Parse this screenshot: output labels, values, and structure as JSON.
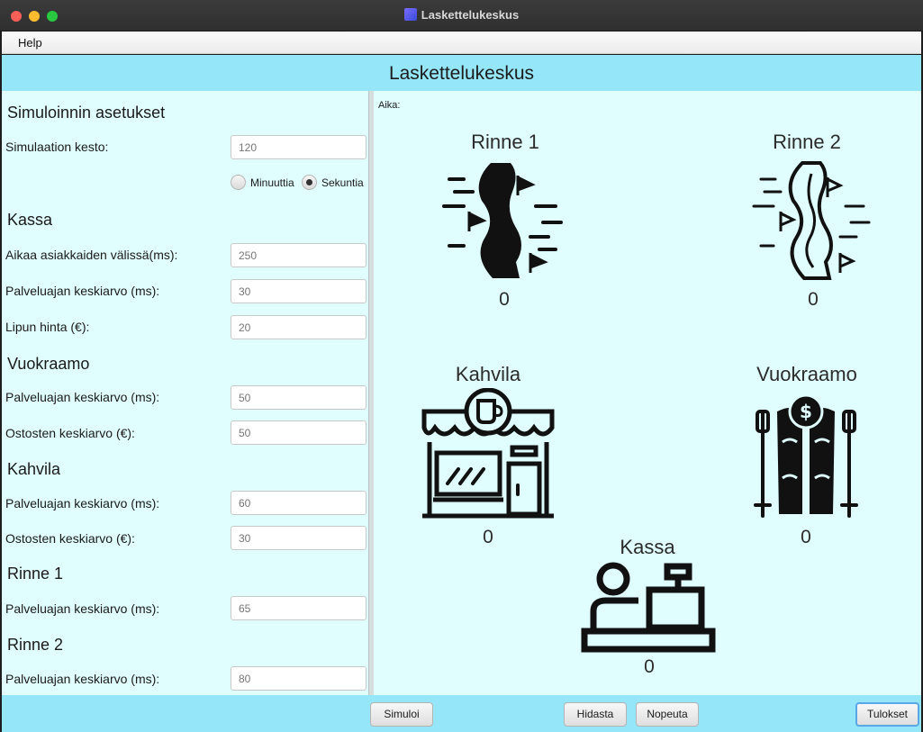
{
  "window": {
    "title": "Laskettelukeskus",
    "app_icon": "app-logo-icon"
  },
  "menu": {
    "items": [
      "Help"
    ]
  },
  "header": {
    "title": "Laskettelukeskus"
  },
  "settings": {
    "title": "Simuloinnin asetukset",
    "duration_label": "Simulaation kesto:",
    "duration_placeholder": "120",
    "unit_minutes": "Minuuttia",
    "unit_seconds": "Sekuntia",
    "unit_selected": "Sekuntia",
    "kassa_title": "Kassa",
    "kassa_interval_label": "Aikaa asiakkaiden välissä(ms):",
    "kassa_interval_placeholder": "250",
    "kassa_service_label": "Palveluajan keskiarvo (ms):",
    "kassa_service_placeholder": "30",
    "kassa_price_label": "Lipun hinta (€):",
    "kassa_price_placeholder": "20",
    "vuokraamo_title": "Vuokraamo",
    "vuokraamo_service_label": "Palveluajan keskiarvo (ms):",
    "vuokraamo_service_placeholder": "50",
    "vuokraamo_purchase_label": "Ostosten keskiarvo (€):",
    "vuokraamo_purchase_placeholder": "50",
    "kahvila_title": "Kahvila",
    "kahvila_service_label": "Palveluajan keskiarvo (ms):",
    "kahvila_service_placeholder": "60",
    "kahvila_purchase_label": "Ostosten keskiarvo (€):",
    "kahvila_purchase_placeholder": "30",
    "rinne1_title": "Rinne 1",
    "rinne1_service_label": "Palveluajan keskiarvo (ms):",
    "rinne1_service_placeholder": "65",
    "rinne2_title": "Rinne 2",
    "rinne2_service_label": "Palveluajan keskiarvo (ms):",
    "rinne2_service_placeholder": "80"
  },
  "simulation": {
    "time_label": "Aika:",
    "stations": {
      "rinne1": {
        "name": "Rinne 1",
        "count": "0",
        "icon": "ski-slope-filled-icon"
      },
      "rinne2": {
        "name": "Rinne 2",
        "count": "0",
        "icon": "ski-slope-outline-icon"
      },
      "kahvila": {
        "name": "Kahvila",
        "count": "0",
        "icon": "cafe-storefront-icon"
      },
      "vuokraamo": {
        "name": "Vuokraamo",
        "count": "0",
        "icon": "ski-rental-icon"
      },
      "kassa": {
        "name": "Kassa",
        "count": "0",
        "icon": "cashier-icon"
      }
    }
  },
  "buttons": {
    "simulate": "Simuloi",
    "slow_down": "Hidasta",
    "speed_up": "Nopeuta",
    "results": "Tulokset"
  },
  "colors": {
    "header_bg": "#94e6f8",
    "panel_bg": "#e0fefe",
    "accent_focus": "#5aa7e8"
  }
}
